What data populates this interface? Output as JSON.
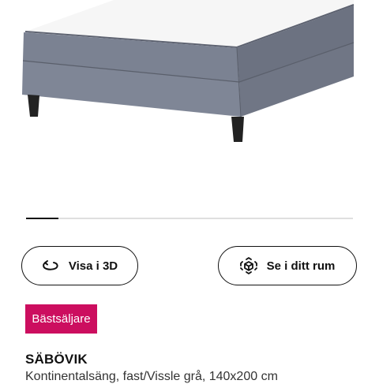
{
  "gallery": {
    "image_alt": "SÄBÖVIK bed",
    "progress": 0.1
  },
  "actions": {
    "view_3d_label": "Visa i 3D",
    "view_room_label": "Se i ditt rum"
  },
  "badge": {
    "label": "Bästsäljare",
    "color": "#cc0e5f"
  },
  "product": {
    "name": "SÄBÖVIK",
    "description": "Kontinentalsäng, fast/Vissle grå, 140x200 cm"
  },
  "icons": {
    "view_3d": "rotate-3d-icon",
    "view_room": "ar-cube-icon"
  }
}
